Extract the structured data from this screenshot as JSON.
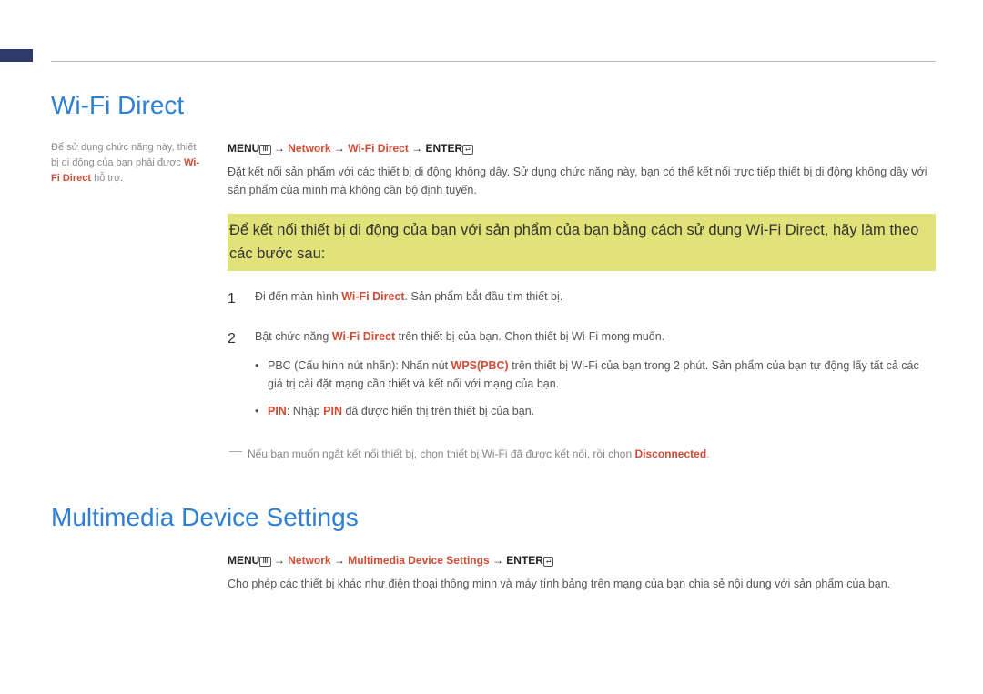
{
  "decor": {},
  "section1": {
    "title": "Wi-Fi Direct",
    "sidenote": {
      "pre": "Để sử dụng chức năng này, thiết bị di động của bạn phải được ",
      "red": "Wi-Fi Direct",
      "post": " hỗ trợ."
    },
    "nav": {
      "menu": "MENU",
      "menuIcon": "Ⅲ",
      "arrow1": " → ",
      "n1": "Network",
      "arrow2": " → ",
      "n2": "Wi-Fi Direct",
      "arrow3": " → ",
      "enter": "ENTER",
      "enterIcon": "↵"
    },
    "body": "Đặt kết nối sản phẩm với các thiết bị di động không dây. Sử dụng chức năng này, bạn có thể kết nối trực tiếp thiết bị di động không dây với sản phẩm của mình mà không cần bộ định tuyến.",
    "highlight": "Để kết nối thiết bị di động của bạn với sản phẩm của bạn bằng cách sử dụng Wi-Fi Direct, hãy làm theo các bước sau:",
    "steps": {
      "s1": {
        "num": "1",
        "pre": "Đi đến màn hình ",
        "red": "Wi-Fi Direct",
        "post": ". Sản phẩm bắt đầu tìm thiết bị."
      },
      "s2": {
        "num": "2",
        "pre": "Bật chức năng ",
        "red": "Wi-Fi Direct",
        "post": " trên thiết bị của bạn. Chọn thiết bị Wi-Fi mong muốn.",
        "sub1": {
          "pre": "PBC (Cấu hình nút nhấn): Nhấn nút ",
          "red": "WPS(PBC)",
          "post": " trên thiết bị Wi-Fi của bạn trong 2 phút. Sản phẩm của bạn tự động lấy tất cả các giá trị cài đặt mạng cần thiết và kết nối với mạng của bạn."
        },
        "sub2": {
          "red1": "PIN",
          "mid": ": Nhập ",
          "red2": "PIN",
          "post": " đã được hiển thị trên thiết bị của bạn."
        }
      }
    },
    "note": {
      "pre": "Nếu bạn muốn ngắt kết nối thiết bị, chọn thiết bị Wi-Fi đã được kết nối, rồi chọn ",
      "red": "Disconnected",
      "post": "."
    }
  },
  "section2": {
    "title": "Multimedia Device Settings",
    "nav": {
      "menu": "MENU",
      "menuIcon": "Ⅲ",
      "arrow1": " → ",
      "n1": "Network",
      "arrow2": " → ",
      "n2": "Multimedia Device Settings",
      "arrow3": " → ",
      "enter": "ENTER",
      "enterIcon": "↵"
    },
    "body": "Cho phép các thiết bị khác như điện thoại thông minh và máy tính bảng trên mạng của bạn chia sẻ nội dung với sản phẩm của bạn."
  }
}
